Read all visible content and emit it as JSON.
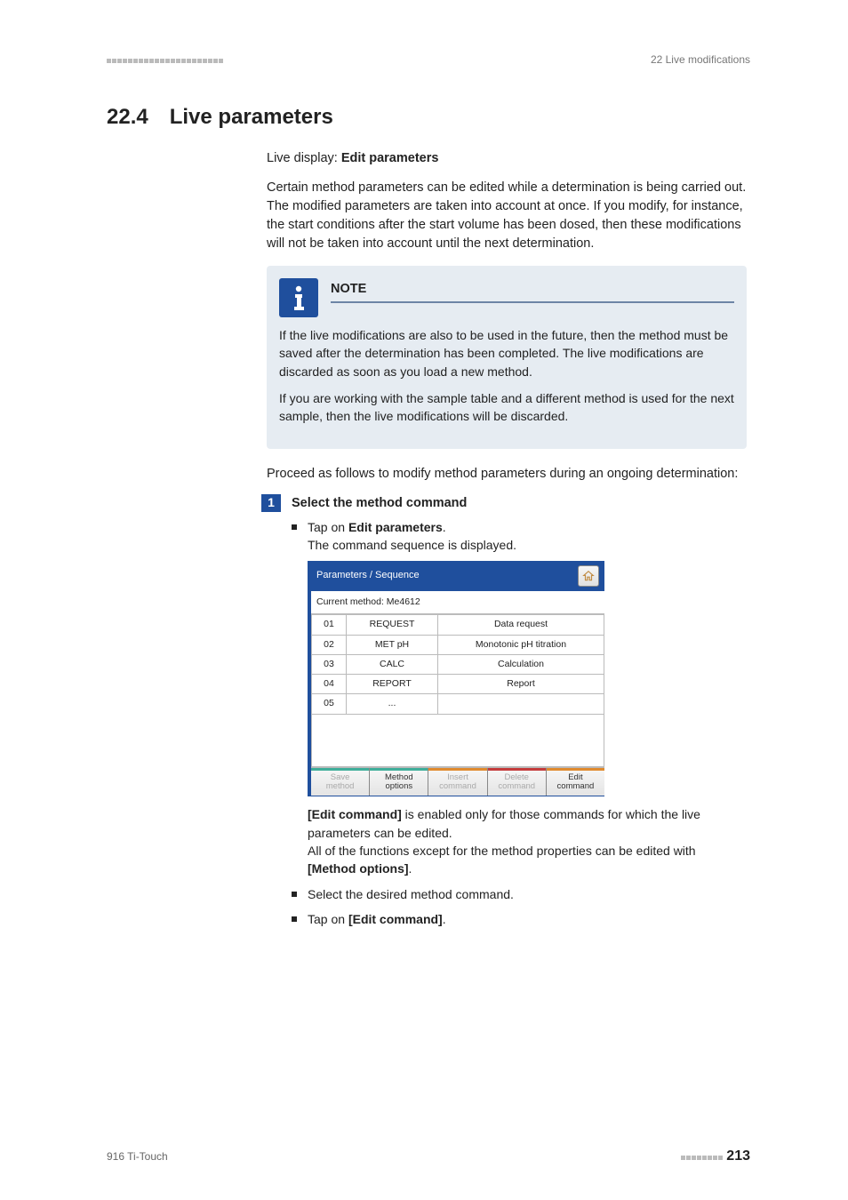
{
  "header": {
    "right": "22 Live modifications"
  },
  "section": {
    "number": "22.4",
    "title": "Live parameters"
  },
  "intro": {
    "live_display_prefix": "Live display: ",
    "live_display_bold": "Edit parameters",
    "paragraph": "Certain method parameters can be edited while a determination is being carried out. The modified parameters are taken into account at once. If you modify, for instance, the start conditions after the start volume has been dosed, then these modifications will not be taken into account until the next determination."
  },
  "note": {
    "title": "NOTE",
    "p1": "If the live modifications are also to be used in the future, then the method must be saved after the determination has been completed. The live modifications are discarded as soon as you load a new method.",
    "p2": "If you are working with the sample table and a different method is used for the next sample, then the live modifications will be discarded."
  },
  "proceed": "Proceed as follows to modify method parameters during an ongoing determination:",
  "step": {
    "num": "1",
    "title": "Select the method command",
    "b1_pre": "Tap on ",
    "b1_bold": "Edit parameters",
    "b1_post": ".",
    "b1_line2": "The command sequence is displayed.",
    "after_shot_bold": "[Edit command]",
    "after_shot_rest": " is enabled only for those commands for which the live parameters can be edited.",
    "after_shot_p2a": "All of the functions except for the method properties can be edited with ",
    "after_shot_p2b": "[Method options]",
    "after_shot_p2c": ".",
    "b2": "Select the desired method command.",
    "b3_pre": "Tap on ",
    "b3_bold": "[Edit command]",
    "b3_post": "."
  },
  "ui": {
    "title": "Parameters / Sequence",
    "subtitle": "Current method: Me4612",
    "rows": [
      {
        "idx": "01",
        "cmd": "REQUEST",
        "desc": "Data request"
      },
      {
        "idx": "02",
        "cmd": "MET pH",
        "desc": "Monotonic pH titration"
      },
      {
        "idx": "03",
        "cmd": "CALC",
        "desc": "Calculation"
      },
      {
        "idx": "04",
        "cmd": "REPORT",
        "desc": "Report"
      },
      {
        "idx": "05",
        "cmd": "...",
        "desc": ""
      }
    ],
    "buttons": {
      "save": {
        "l1": "Save",
        "l2": "method"
      },
      "method": {
        "l1": "Method",
        "l2": "options"
      },
      "insert": {
        "l1": "Insert",
        "l2": "command"
      },
      "delete": {
        "l1": "Delete",
        "l2": "command"
      },
      "edit": {
        "l1": "Edit",
        "l2": "command"
      }
    }
  },
  "footer": {
    "left": "916 Ti-Touch",
    "page": "213"
  }
}
